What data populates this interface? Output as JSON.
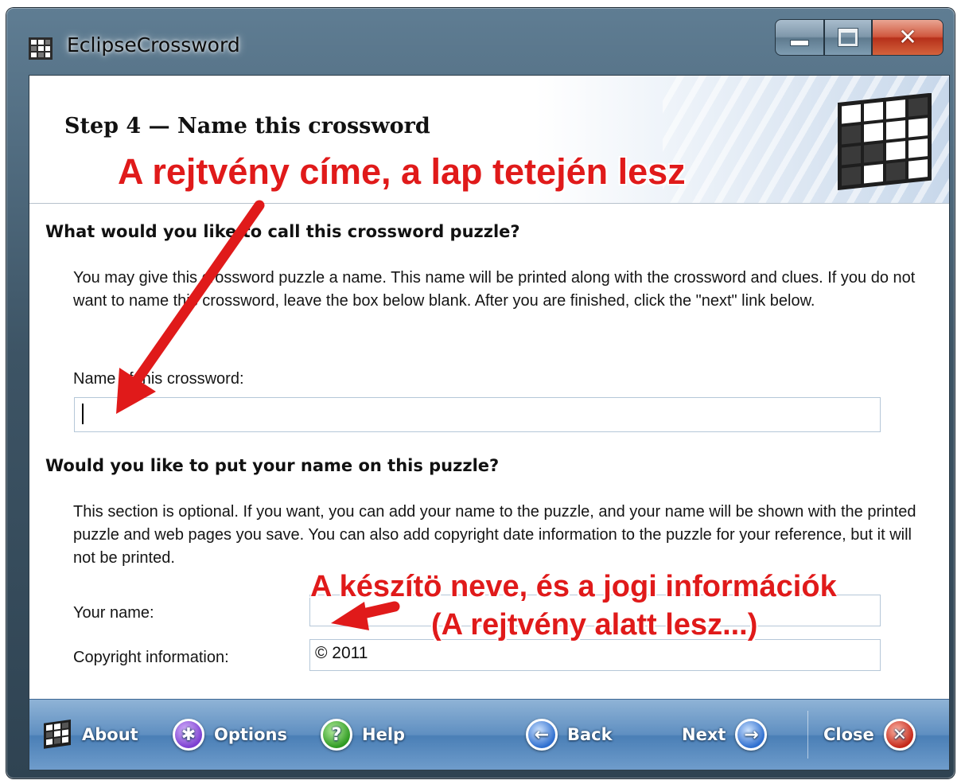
{
  "window": {
    "title": "EclipseCrossword",
    "icons": {
      "app": "crossword-grid-icon",
      "minimize": "minimize-icon",
      "maximize": "maximize-icon",
      "close": "close-x-icon"
    }
  },
  "header": {
    "step_title": "Step 4 — Name this crossword",
    "logo_icon": "crossword-grid-logo"
  },
  "section1": {
    "heading": "What would you like to call this crossword puzzle?",
    "paragraph": "You may give this crossword puzzle a name.  This name will be printed along with the crossword and clues.  If you do not want to name this crossword, leave the box below blank.  After you are finished, click the \"next\" link below.",
    "field_label": "Name of this crossword:",
    "field_value": ""
  },
  "section2": {
    "heading": "Would you like to put your name on this puzzle?",
    "paragraph": "This section is optional.  If you want, you can add your name to the puzzle, and your name will be shown with the printed puzzle and web pages you save.  You can also add copyright date information to the puzzle for your reference, but it will not be printed.",
    "your_name_label": "Your name:",
    "your_name_value": "",
    "copyright_label": "Copyright information:",
    "copyright_value": "© 2011"
  },
  "toolbar": {
    "about": "About",
    "options": "Options",
    "help": "Help",
    "back": "Back",
    "next": "Next",
    "close": "Close",
    "icons": {
      "about": "crossword-grid-icon",
      "options": "options-icon",
      "help": "help-icon",
      "back": "back-arrow-icon",
      "next": "next-arrow-icon",
      "close": "close-icon"
    }
  },
  "annotations": {
    "title_note": "A rejtvény címe, a lap tetején lesz",
    "author_note_line1": "A készítö neve, és a jogi információk",
    "author_note_line2": "(A rejtvény alatt lesz...)",
    "color": "#e01a1a"
  }
}
